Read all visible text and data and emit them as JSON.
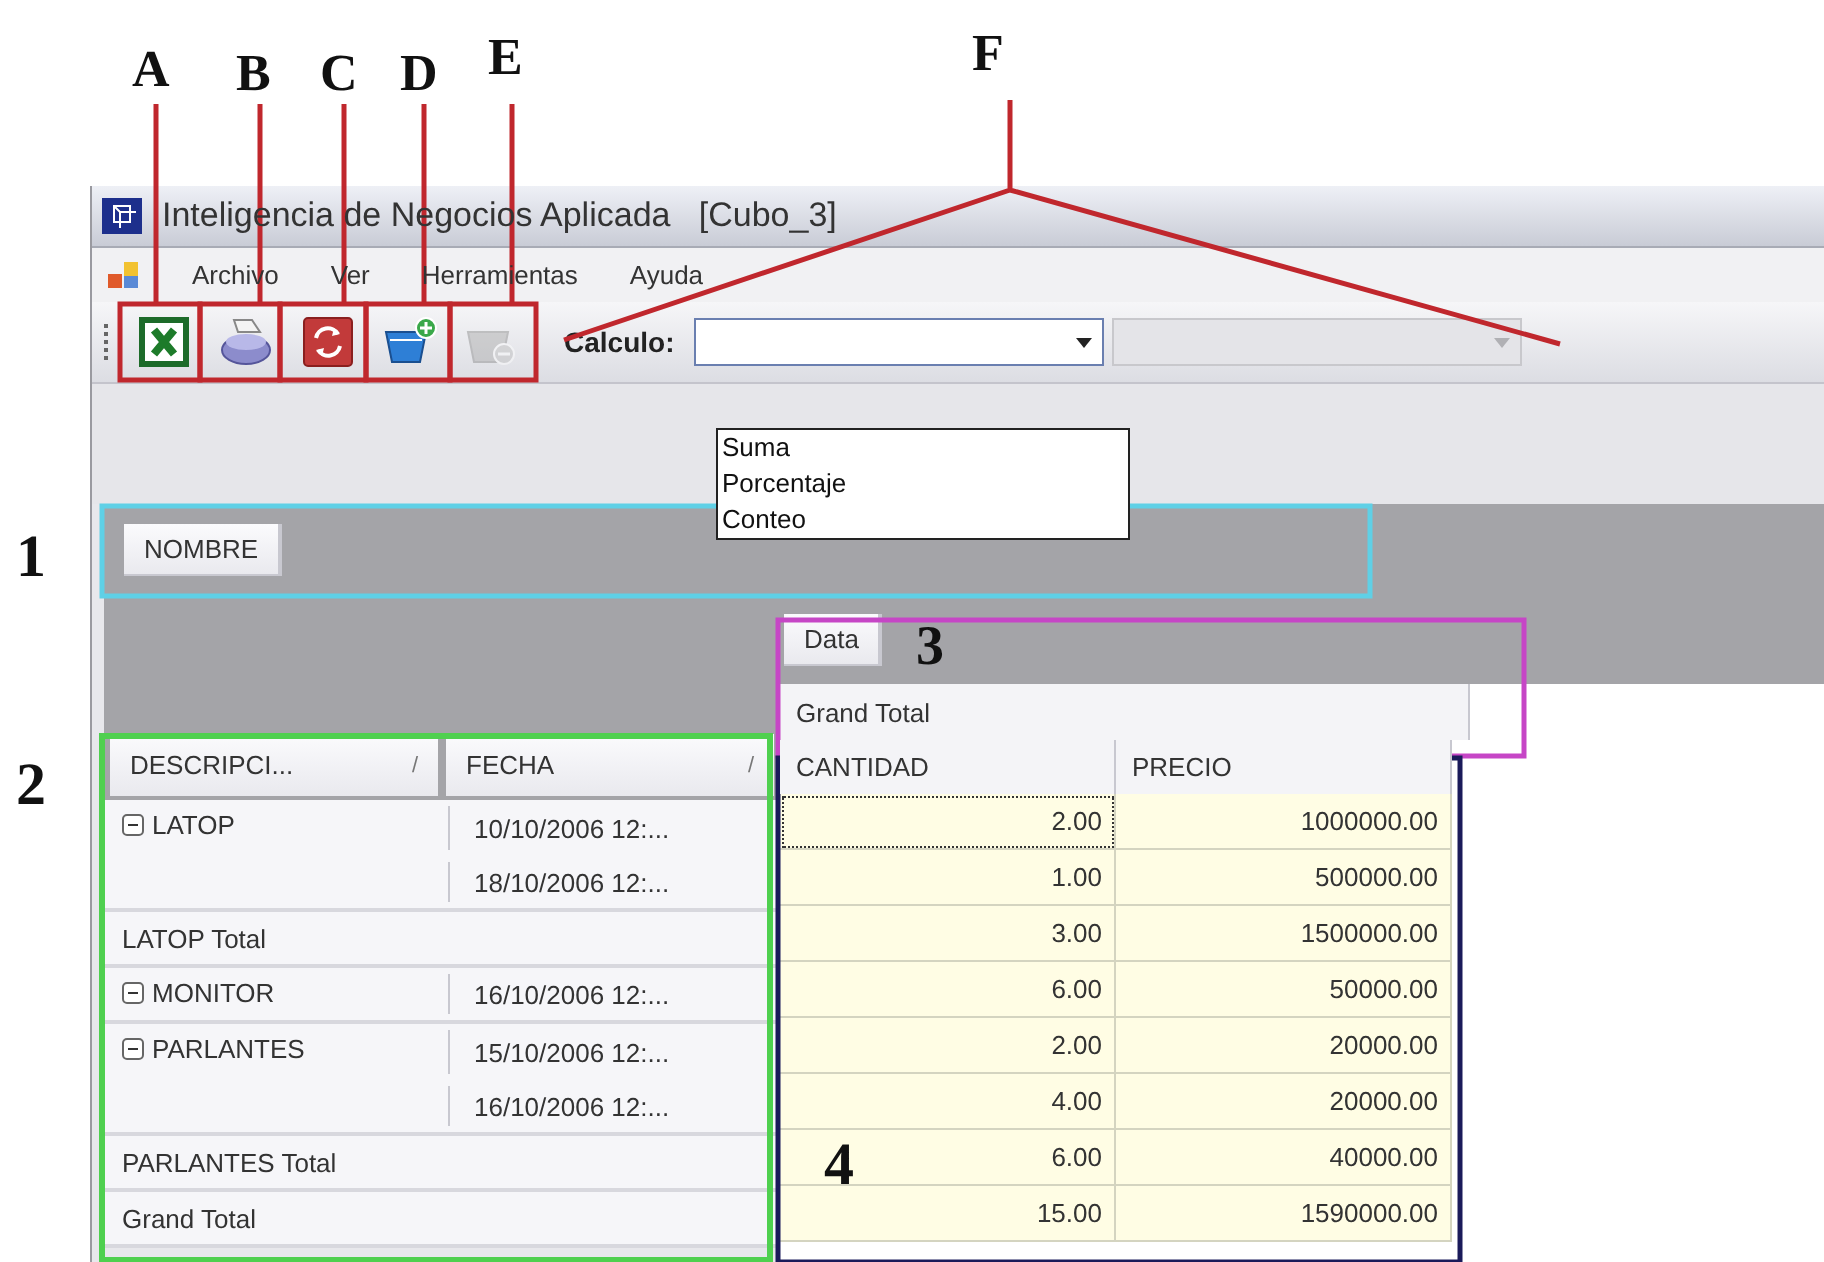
{
  "callouts": [
    {
      "label": "A"
    },
    {
      "label": "B"
    },
    {
      "label": "C"
    },
    {
      "label": "D"
    },
    {
      "label": "E"
    },
    {
      "label": "F"
    }
  ],
  "markers": [
    {
      "label": "1"
    },
    {
      "label": "2"
    },
    {
      "label": "3"
    },
    {
      "label": "4"
    }
  ],
  "window": {
    "title": "Inteligencia de Negocios Aplicada   [Cubo_3]"
  },
  "menu": [
    "Archivo",
    "Ver",
    "Herramientas",
    "Ayuda"
  ],
  "toolbar": {
    "buttons": [
      {
        "kind": "excel",
        "disabled": false
      },
      {
        "kind": "print",
        "disabled": false
      },
      {
        "kind": "refresh",
        "disabled": false
      },
      {
        "kind": "add",
        "disabled": false
      },
      {
        "kind": "remove",
        "disabled": true
      }
    ],
    "calc_label": "Calculo:",
    "calc_combo": {
      "expanded": true,
      "options": [
        "Suma",
        "Porcentaje",
        "Conteo"
      ]
    },
    "second_combo": {
      "disabled": true
    }
  },
  "pivot": {
    "filter_fields": [
      "NOMBRE"
    ],
    "data_field": "Data",
    "column_header": "Grand Total",
    "row_fields": [
      {
        "label": "DESCRIPCI...",
        "sort": "/"
      },
      {
        "label": "FECHA",
        "sort": "/"
      }
    ],
    "data_columns": [
      "CANTIDAD",
      "PRECIO"
    ],
    "rows": [
      {
        "kind": "detail",
        "description": "LATOP",
        "expanded": true,
        "fecha": "10/10/2006 12:...",
        "cantidad": "2.00",
        "precio": "1000000.00",
        "focused": true
      },
      {
        "kind": "continuation",
        "fecha": "18/10/2006 12:...",
        "cantidad": "1.00",
        "precio": "500000.00",
        "focused": false
      },
      {
        "kind": "total",
        "label": "LATOP Total",
        "cantidad": "3.00",
        "precio": "1500000.00",
        "focused": false
      },
      {
        "kind": "detail",
        "description": "MONITOR",
        "expanded": true,
        "fecha": "16/10/2006 12:...",
        "cantidad": "6.00",
        "precio": "50000.00",
        "focused": false
      },
      {
        "kind": "detail",
        "description": "PARLANTES",
        "expanded": true,
        "fecha": "15/10/2006 12:...",
        "cantidad": "2.00",
        "precio": "20000.00",
        "focused": false
      },
      {
        "kind": "continuation",
        "fecha": "16/10/2006 12:...",
        "cantidad": "4.00",
        "precio": "20000.00",
        "focused": false
      },
      {
        "kind": "total",
        "label": "PARLANTES Total",
        "cantidad": "6.00",
        "precio": "40000.00",
        "focused": false
      },
      {
        "kind": "total",
        "label": "Grand Total",
        "cantidad": "15.00",
        "precio": "1590000.00",
        "focused": false
      }
    ]
  }
}
